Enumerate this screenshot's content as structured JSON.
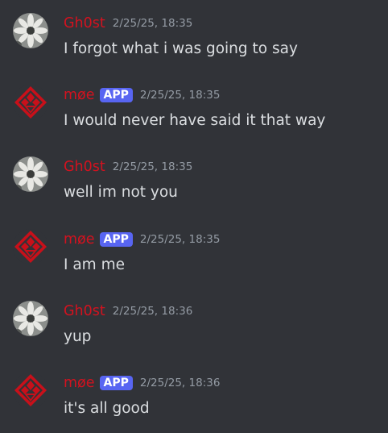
{
  "messages": [
    {
      "author": "Gh0st",
      "timestamp": "2/25/25, 18:35",
      "content": "I forgot what i was going to say",
      "avatar": "flower-avatar"
    },
    {
      "author": "møe",
      "badge": "APP",
      "timestamp": "2/25/25, 18:35",
      "content": "I would never have said it that way",
      "avatar": "red-logo-avatar"
    },
    {
      "author": "Gh0st",
      "timestamp": "2/25/25, 18:35",
      "content": "well im not you",
      "avatar": "flower-avatar"
    },
    {
      "author": "møe",
      "badge": "APP",
      "timestamp": "2/25/25, 18:35",
      "content": "I am me",
      "avatar": "red-logo-avatar"
    },
    {
      "author": "Gh0st",
      "timestamp": "2/25/25, 18:36",
      "content": "yup",
      "avatar": "flower-avatar"
    },
    {
      "author": "møe",
      "badge": "APP",
      "timestamp": "2/25/25, 18:36",
      "content": "it's all good",
      "avatar": "red-logo-avatar"
    }
  ],
  "colors": {
    "background": "#313338",
    "username": "#d3121f",
    "badge": "#5865f2",
    "timestamp": "#949ba4",
    "text": "#dbdee1"
  }
}
